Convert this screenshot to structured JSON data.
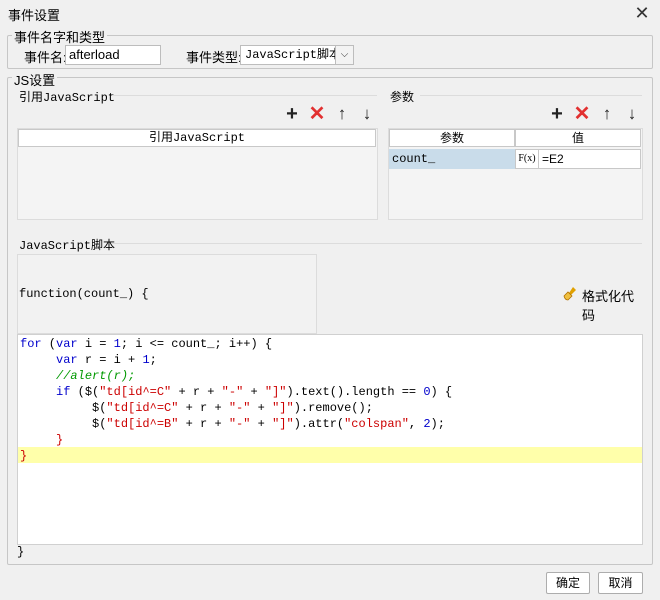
{
  "window": {
    "title": "事件设置",
    "close_symbol": "✕"
  },
  "event_group": {
    "legend": "事件名字和类型",
    "name_label": "事件名:",
    "name_value": "afterload",
    "type_label": "事件类型:",
    "type_value": "JavaScript脚本"
  },
  "js_group": {
    "legend": "JS设置"
  },
  "ref_js": {
    "title": "引用JavaScript",
    "column_header": "引用JavaScript",
    "toolbar": {
      "add": "+",
      "delete": "✕",
      "up": "↑",
      "down": "↓"
    }
  },
  "params": {
    "title": "参数",
    "headers": {
      "name": "参数",
      "value": "值"
    },
    "rows": [
      {
        "name": "count_",
        "formula_icon": "F(x)",
        "value": "=E2"
      }
    ],
    "toolbar": {
      "add": "+",
      "delete": "✕",
      "up": "↑",
      "down": "↓"
    }
  },
  "script": {
    "title": "JavaScript脚本",
    "header_text": "function(count_) {",
    "format_button": "格式化代码",
    "format_icon": "broom-icon",
    "footer_text": "}",
    "code_lines": [
      [
        [
          "kw",
          "for"
        ],
        [
          "p",
          " ("
        ],
        [
          "kw",
          "var"
        ],
        [
          "p",
          " i = "
        ],
        [
          "num",
          "1"
        ],
        [
          "p",
          "; i <= count_; i++) {"
        ]
      ],
      [
        [
          "p",
          "     "
        ],
        [
          "kw",
          "var"
        ],
        [
          "p",
          " r = i + "
        ],
        [
          "num",
          "1"
        ],
        [
          "p",
          ";"
        ]
      ],
      [
        [
          "p",
          "     "
        ],
        [
          "cmt",
          "//alert(r);"
        ]
      ],
      [
        [
          "p",
          "     "
        ],
        [
          "kw",
          "if"
        ],
        [
          "p",
          " ($("
        ],
        [
          "str",
          "\"td[id^=C\""
        ],
        [
          "p",
          " + r + "
        ],
        [
          "str",
          "\"-\""
        ],
        [
          "p",
          " + "
        ],
        [
          "str",
          "\"]\""
        ],
        [
          "p",
          ").text().length == "
        ],
        [
          "num",
          "0"
        ],
        [
          "p",
          ") {"
        ]
      ],
      [
        [
          "p",
          "          $("
        ],
        [
          "str",
          "\"td[id^=C\""
        ],
        [
          "p",
          " + r + "
        ],
        [
          "str",
          "\"-\""
        ],
        [
          "p",
          " + "
        ],
        [
          "str",
          "\"]\""
        ],
        [
          "p",
          ").remove();"
        ]
      ],
      [
        [
          "p",
          "          $("
        ],
        [
          "str",
          "\"td[id^=B\""
        ],
        [
          "p",
          " + r + "
        ],
        [
          "str",
          "\"-\""
        ],
        [
          "p",
          " + "
        ],
        [
          "str",
          "\"]\""
        ],
        [
          "p",
          ").attr("
        ],
        [
          "str",
          "\"colspan\""
        ],
        [
          "p",
          ", "
        ],
        [
          "num",
          "2"
        ],
        [
          "p",
          ");"
        ]
      ],
      [
        [
          "p",
          "     "
        ],
        [
          "str",
          "}"
        ]
      ],
      [
        [
          "str",
          "}"
        ]
      ]
    ]
  },
  "buttons": {
    "ok": "确定",
    "cancel": "取消"
  },
  "colors": {
    "keyword": "#0000cc",
    "string": "#cc0000",
    "comment": "#009900",
    "highlight": "#ffffaa",
    "delete": "#e23030"
  }
}
